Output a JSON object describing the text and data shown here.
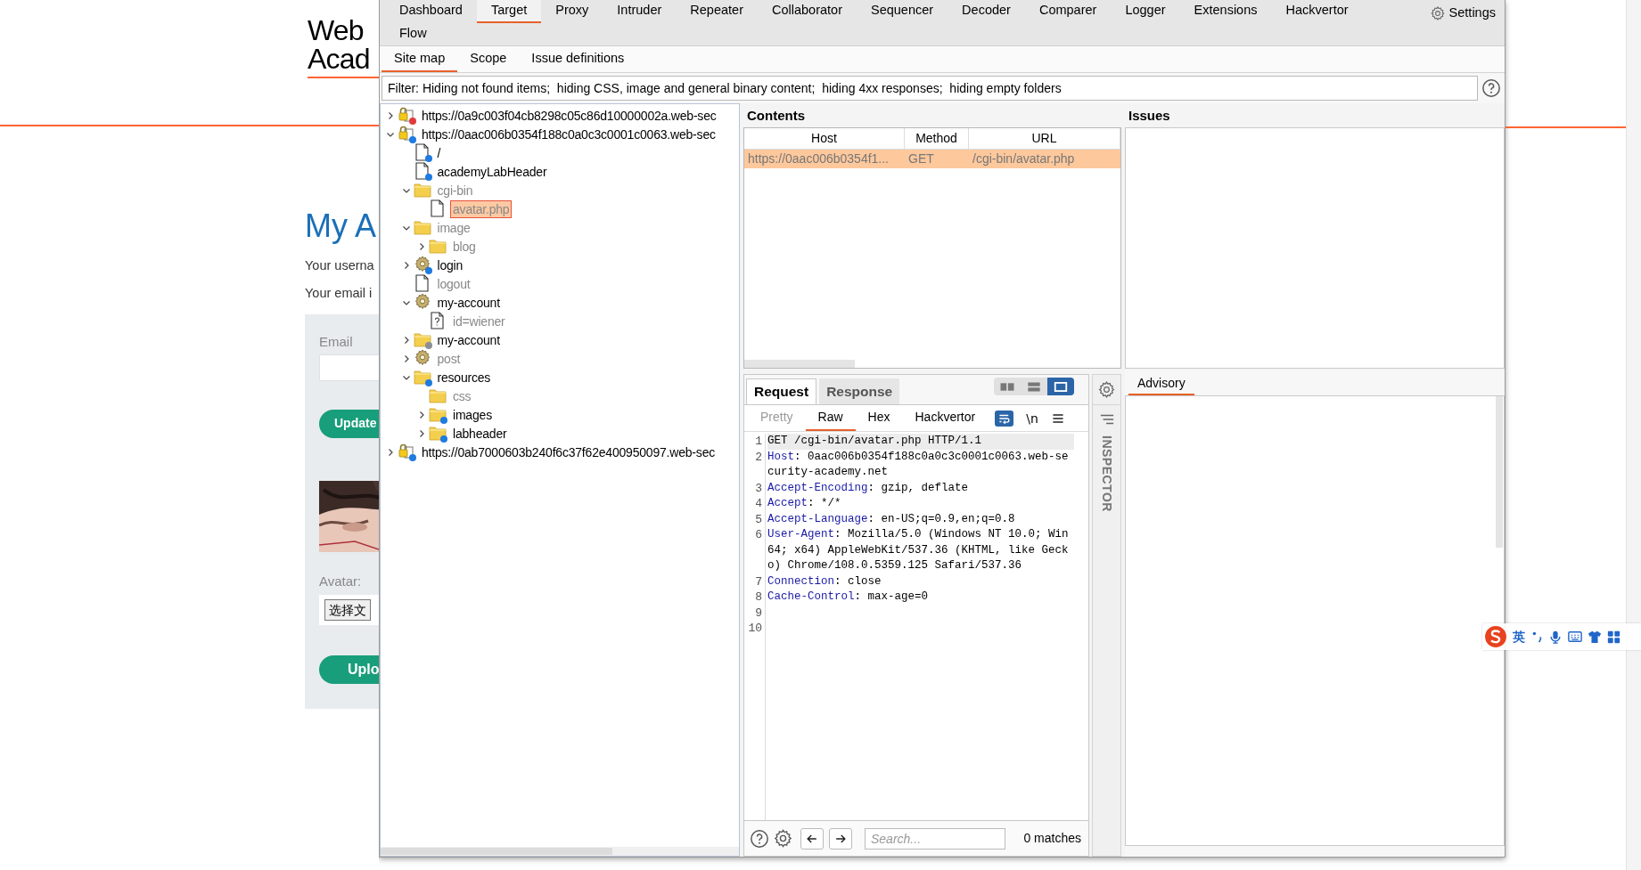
{
  "background_page": {
    "logo_lines": [
      "Web",
      "Acad"
    ],
    "heading": "My A",
    "info_lines": [
      "Your userna",
      "Your email i"
    ],
    "email_label": "Email",
    "update_button": "Update",
    "avatar_label": "Avatar:",
    "file_button": "选择文",
    "upload_button": "Uplo"
  },
  "burp": {
    "main_tab_rows": [
      [
        {
          "label": "Dashboard",
          "selected": false
        },
        {
          "label": "Target",
          "selected": true
        },
        {
          "label": "Proxy",
          "selected": false
        },
        {
          "label": "Intruder",
          "selected": false
        },
        {
          "label": "Repeater",
          "selected": false
        },
        {
          "label": "Collaborator",
          "selected": false
        },
        {
          "label": "Sequencer",
          "selected": false
        },
        {
          "label": "Decoder",
          "selected": false
        },
        {
          "label": "Comparer",
          "selected": false
        },
        {
          "label": "Logger",
          "selected": false
        },
        {
          "label": "Extensions",
          "selected": false
        },
        {
          "label": "Hackvertor",
          "selected": false
        }
      ],
      [
        {
          "label": "Flow",
          "selected": false
        }
      ]
    ],
    "settings_button": "Settings",
    "sub_tabs": [
      {
        "label": "Site map",
        "selected": true
      },
      {
        "label": "Scope",
        "selected": false
      },
      {
        "label": "Issue definitions",
        "selected": false
      }
    ],
    "filter": "Filter: Hiding not found items;  hiding CSS, image and general binary content;  hiding 4xx responses;  hiding empty folders",
    "site_tree": [
      {
        "kind": "host",
        "color": "#e03a3a",
        "label": "https://0a9c003f04cb8298c05c86d10000002a.web-sec",
        "muted": false,
        "selected": false,
        "expanded": false
      },
      {
        "kind": "host",
        "color": "#1e7be0",
        "label": "https://0aac006b0354f188c0a0c3c0001c0063.web-sec",
        "muted": false,
        "selected": false,
        "expanded": true,
        "children": [
          {
            "kind": "file",
            "color": "#1e7be0",
            "label": "/",
            "muted": false,
            "selected": false
          },
          {
            "kind": "file",
            "color": "#1e7be0",
            "label": "academyLabHeader",
            "muted": false,
            "selected": false
          },
          {
            "kind": "folder",
            "label": "cgi-bin",
            "muted": true,
            "selected": false,
            "expanded": true,
            "children": [
              {
                "kind": "file",
                "label": "avatar.php",
                "muted": true,
                "selected": true
              }
            ]
          },
          {
            "kind": "folder",
            "label": "image",
            "muted": true,
            "selected": false,
            "expanded": true,
            "children": [
              {
                "kind": "folder",
                "label": "blog",
                "muted": true,
                "selected": false,
                "expanded": false
              }
            ]
          },
          {
            "kind": "gear",
            "color": "#1e7be0",
            "label": "login",
            "muted": false,
            "selected": false,
            "expanded": false
          },
          {
            "kind": "file",
            "label": "logout",
            "muted": true,
            "selected": false
          },
          {
            "kind": "gear",
            "label": "my-account",
            "muted": false,
            "selected": false,
            "expanded": true,
            "children": [
              {
                "kind": "unknown",
                "label": "id=wiener",
                "muted": true,
                "selected": false
              }
            ]
          },
          {
            "kind": "folder",
            "color": "#8a8f96",
            "label": "my-account",
            "muted": false,
            "selected": false,
            "expanded": false
          },
          {
            "kind": "gear",
            "label": "post",
            "muted": true,
            "selected": false,
            "expanded": false
          },
          {
            "kind": "folder",
            "color": "#1e7be0",
            "label": "resources",
            "muted": false,
            "selected": false,
            "expanded": true,
            "children": [
              {
                "kind": "folder",
                "label": "css",
                "muted": true,
                "selected": false
              },
              {
                "kind": "folder",
                "color": "#1e7be0",
                "label": "images",
                "muted": false,
                "selected": false,
                "expanded": false
              },
              {
                "kind": "folder",
                "color": "#1e7be0",
                "label": "labheader",
                "muted": false,
                "selected": false,
                "expanded": false
              }
            ]
          }
        ]
      },
      {
        "kind": "host",
        "color": "#1e7be0",
        "label": "https://0ab7000603b240f6c37f62e400950097.web-sec",
        "muted": false,
        "selected": false,
        "expanded": false
      }
    ],
    "contents": {
      "title": "Contents",
      "columns": [
        "Host",
        "Method",
        "URL"
      ],
      "rows": [
        {
          "cells": [
            "https://0aac006b0354f1...",
            "GET",
            "/cgi-bin/avatar.php"
          ],
          "selected": true
        }
      ]
    },
    "editor": {
      "tabs": [
        {
          "label": "Request",
          "selected": true
        },
        {
          "label": "Response",
          "selected": false
        }
      ],
      "view_modes": [
        {
          "kind": "side-by-side",
          "selected": false
        },
        {
          "kind": "stacked",
          "selected": false
        },
        {
          "kind": "single",
          "selected": true
        }
      ],
      "format_tabs": [
        {
          "label": "Pretty",
          "selected": false,
          "disabled": true
        },
        {
          "label": "Raw",
          "selected": true,
          "disabled": false
        },
        {
          "label": "Hex",
          "selected": false,
          "disabled": false
        },
        {
          "label": "Hackvertor",
          "selected": false,
          "disabled": false
        }
      ],
      "wrap_on": true,
      "newline_toggle": "\\n",
      "lines": [
        {
          "number": "1",
          "value": "GET /cgi-bin/avatar.php HTTP/1.1",
          "highlighted": true
        },
        {
          "number": "2",
          "key": "Host",
          "value": ": 0aac006b0354f188c0a0c3c0001c0063.web-security-academy.net",
          "highlighted": false
        },
        {
          "number": "3",
          "key": "Accept-Encoding",
          "value": ": gzip, deflate",
          "highlighted": false
        },
        {
          "number": "4",
          "key": "Accept",
          "value": ": */*",
          "highlighted": false
        },
        {
          "number": "5",
          "key": "Accept-Language",
          "value": ": en-US;q=0.9,en;q=0.8",
          "highlighted": false
        },
        {
          "number": "6",
          "key": "User-Agent",
          "value": ": Mozilla/5.0 (Windows NT 10.0; Win64; x64) AppleWebKit/537.36 (KHTML, like Gecko) Chrome/108.0.5359.125 Safari/537.36",
          "highlighted": false
        },
        {
          "number": "7",
          "key": "Connection",
          "value": ": close",
          "highlighted": false
        },
        {
          "number": "8",
          "key": "Cache-Control",
          "value": ": max-age=0",
          "highlighted": false
        },
        {
          "number": "9",
          "highlighted": false
        },
        {
          "number": "10",
          "highlighted": false
        }
      ],
      "search_placeholder": "Search...",
      "matches": "0 matches"
    },
    "inspector_label": "INSPECTOR",
    "issues_title": "Issues",
    "advisory_tabs": [
      {
        "label": "Advisory",
        "selected": true
      }
    ]
  },
  "ime_bar": {
    "language": "英"
  }
}
